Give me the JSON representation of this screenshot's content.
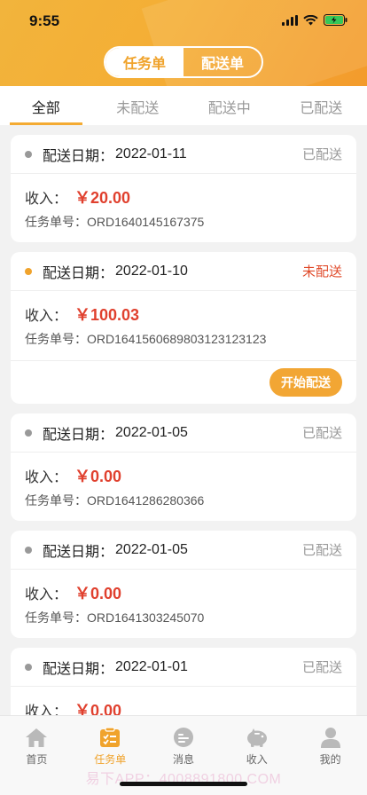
{
  "status": {
    "time": "9:55"
  },
  "segment": {
    "left": "任务单",
    "right": "配送单"
  },
  "tabs": [
    "全部",
    "未配送",
    "配送中",
    "已配送"
  ],
  "orders": [
    {
      "date_label": "配送日期：",
      "date": "2022-01-11",
      "state": "已配送",
      "income_label": "收入：",
      "amount": "￥20.00",
      "order_label": "任务单号：",
      "order_no": "ORD1640145167375"
    },
    {
      "date_label": "配送日期：",
      "date": "2022-01-10",
      "state": "未配送",
      "income_label": "收入：",
      "amount": "￥100.03",
      "order_label": "任务单号：",
      "order_no": "ORD16415606898031231231​23",
      "button": "开始配送"
    },
    {
      "date_label": "配送日期：",
      "date": "2022-01-05",
      "state": "已配送",
      "income_label": "收入：",
      "amount": "￥0.00",
      "order_label": "任务单号：",
      "order_no": "ORD1641286280366"
    },
    {
      "date_label": "配送日期：",
      "date": "2022-01-05",
      "state": "已配送",
      "income_label": "收入：",
      "amount": "￥0.00",
      "order_label": "任务单号：",
      "order_no": "ORD1641303245070"
    },
    {
      "date_label": "配送日期：",
      "date": "2022-01-01",
      "state": "已配送",
      "income_label": "收入：",
      "amount": "￥0.00"
    }
  ],
  "tabbar": [
    {
      "label": "首页",
      "icon": "home-icon"
    },
    {
      "label": "任务单",
      "icon": "task-list-icon"
    },
    {
      "label": "消息",
      "icon": "message-icon"
    },
    {
      "label": "收入",
      "icon": "piggy-bank-icon"
    },
    {
      "label": "我的",
      "icon": "user-icon"
    }
  ],
  "watermark": "易下APP：4008891800.COM",
  "colors": {
    "accent": "#f0a32c",
    "amount": "#e0402e",
    "pending": "#e04b2b"
  }
}
